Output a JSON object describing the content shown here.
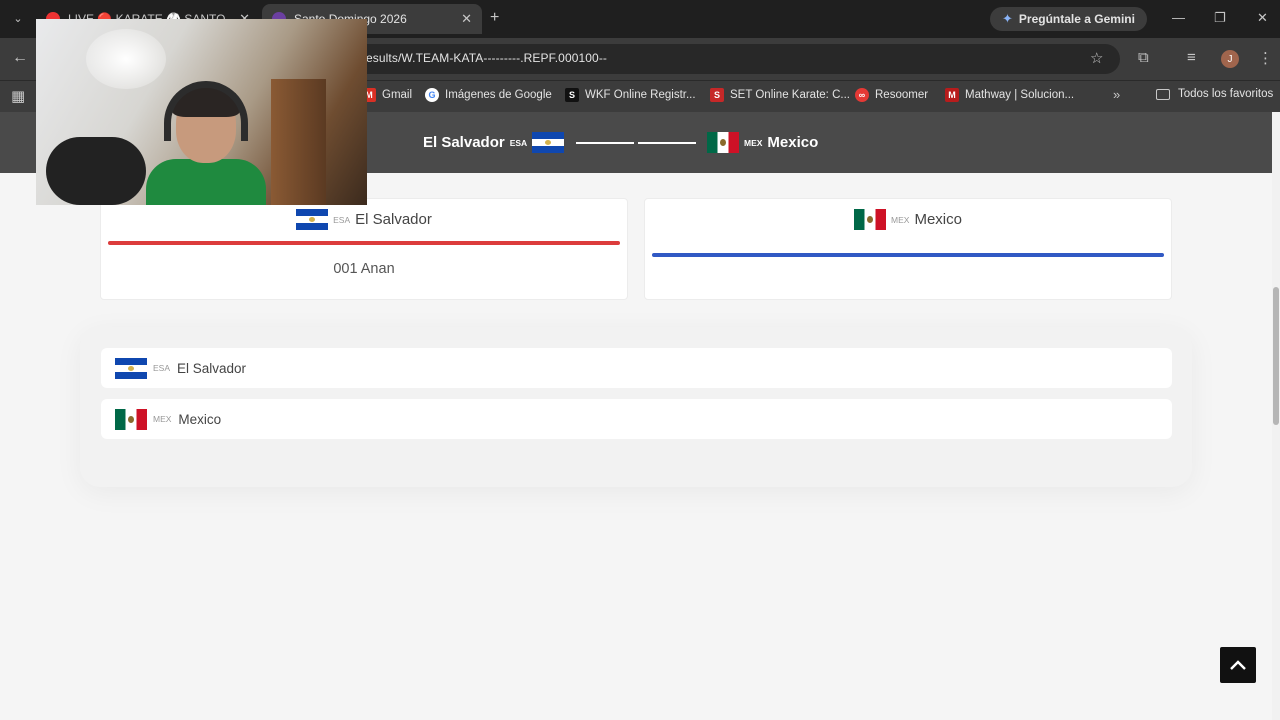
{
  "browser": {
    "tabs": [
      {
        "title": "LIVE 🔴 KARATE 🥋 SANTO",
        "active": false
      },
      {
        "title": "Santo Domingo 2026",
        "active": true
      }
    ],
    "gemini_label": "Pregúntale a Gemini",
    "url": "esults/W.TEAM-KATA---------.REPF.000100--",
    "avatar_letter": "J",
    "bookmarks": [
      {
        "label": "Gmail",
        "icon": "gmail-icon"
      },
      {
        "label": "Imágenes de Google",
        "icon": "google-icon"
      },
      {
        "label": "WKF Online Registr...",
        "icon": "wkf-icon"
      },
      {
        "label": "SET Online Karate: C...",
        "icon": "set-icon"
      },
      {
        "label": "Resoomer",
        "icon": "resoomer-icon"
      },
      {
        "label": "Mathway | Solucion...",
        "icon": "mathway-icon"
      }
    ],
    "all_bookmarks_label": "Todos los favoritos"
  },
  "match": {
    "left": {
      "name": "El Salvador",
      "code": "ESA"
    },
    "right": {
      "name": "Mexico",
      "code": "MEX"
    }
  },
  "cards": {
    "red": {
      "name": "El Salvador",
      "code": "ESA",
      "athlete": "001 Anan",
      "accent": "#dc3c3c"
    },
    "blue": {
      "name": "Mexico",
      "code": "MEX",
      "athlete": "",
      "accent": "#3159c4"
    }
  },
  "ranking": [
    {
      "name": "El Salvador",
      "code": "ESA"
    },
    {
      "name": "Mexico",
      "code": "MEX"
    }
  ]
}
